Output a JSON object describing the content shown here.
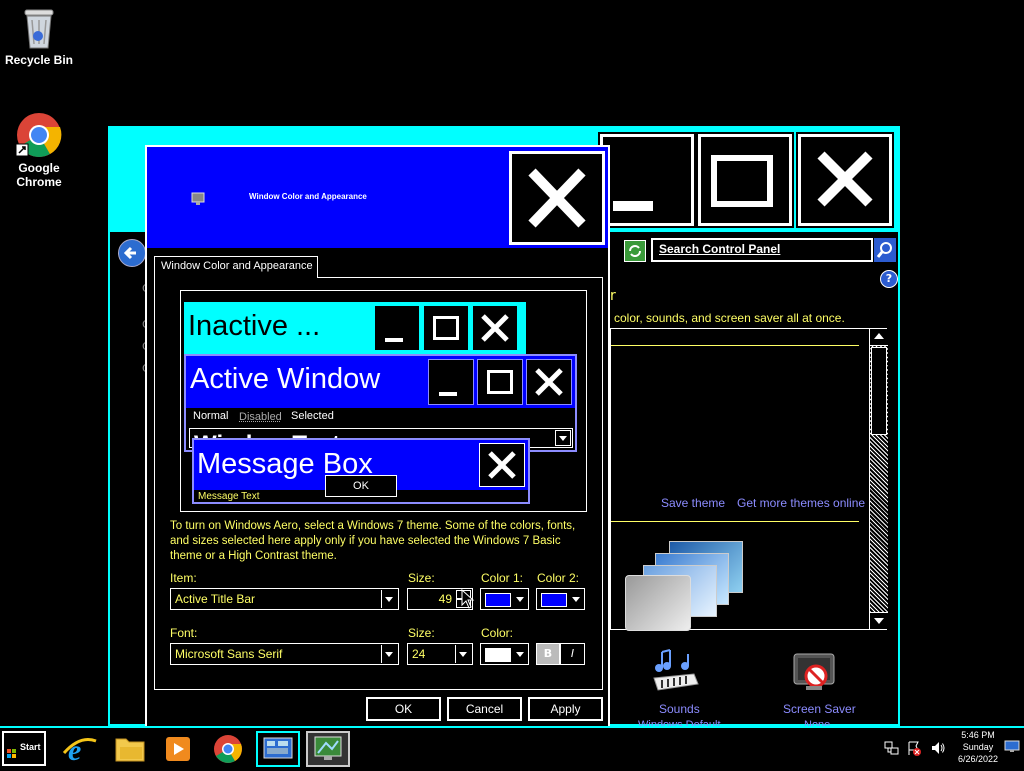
{
  "desktop": {
    "icons": [
      {
        "label": "Recycle Bin",
        "icon": "recycle-bin-icon"
      },
      {
        "label": "Google\nChrome",
        "icon": "chrome-icon"
      }
    ]
  },
  "control_panel": {
    "search_placeholder": "Search Control Panel",
    "intro_text": "color, sounds, and screen saver all at once.",
    "save_theme": "Save theme",
    "get_more_themes": "Get more themes online",
    "sounds_label": "Sounds",
    "screen_saver_label": "Screen Saver",
    "sounds_sublabel": "Windows Default",
    "screen_saver_sublabel": "None"
  },
  "dialog": {
    "title": "Window Color and Appearance",
    "tab_label": "Window Color and Appearance",
    "preview": {
      "inactive": "Inactive ...",
      "active": "Active Window",
      "menu_normal": "Normal",
      "menu_disabled": "Disabled",
      "menu_selected": "Selected",
      "window_text": "Window Text",
      "message_box": "Message Box",
      "message_text": "Message Text",
      "ok": "OK"
    },
    "info_text": "To turn on Windows Aero, select a Windows 7 theme.  Some of the colors, fonts, and sizes selected here apply only if you have selected the Windows 7 Basic theme or a High Contrast theme.",
    "item_label": "Item:",
    "item_value": "Active Title Bar",
    "size_label": "Size:",
    "size_value": "49",
    "color1_label": "Color 1:",
    "color2_label": "Color 2:",
    "font_label": "Font:",
    "font_value": "Microsoft Sans Serif",
    "font_size_label": "Size:",
    "font_size_value": "24",
    "font_color_label": "Color:",
    "bold": "B",
    "italic": "I",
    "ok": "OK",
    "cancel": "Cancel",
    "apply": "Apply"
  },
  "taskbar": {
    "start": "Start",
    "time": "5:46 PM",
    "day": "Sunday",
    "date": "6/26/2022"
  },
  "colors": {
    "cyan": "#00ffff",
    "blue": "#0000ff",
    "yellow": "#ffff66",
    "link": "#8c8cff"
  }
}
